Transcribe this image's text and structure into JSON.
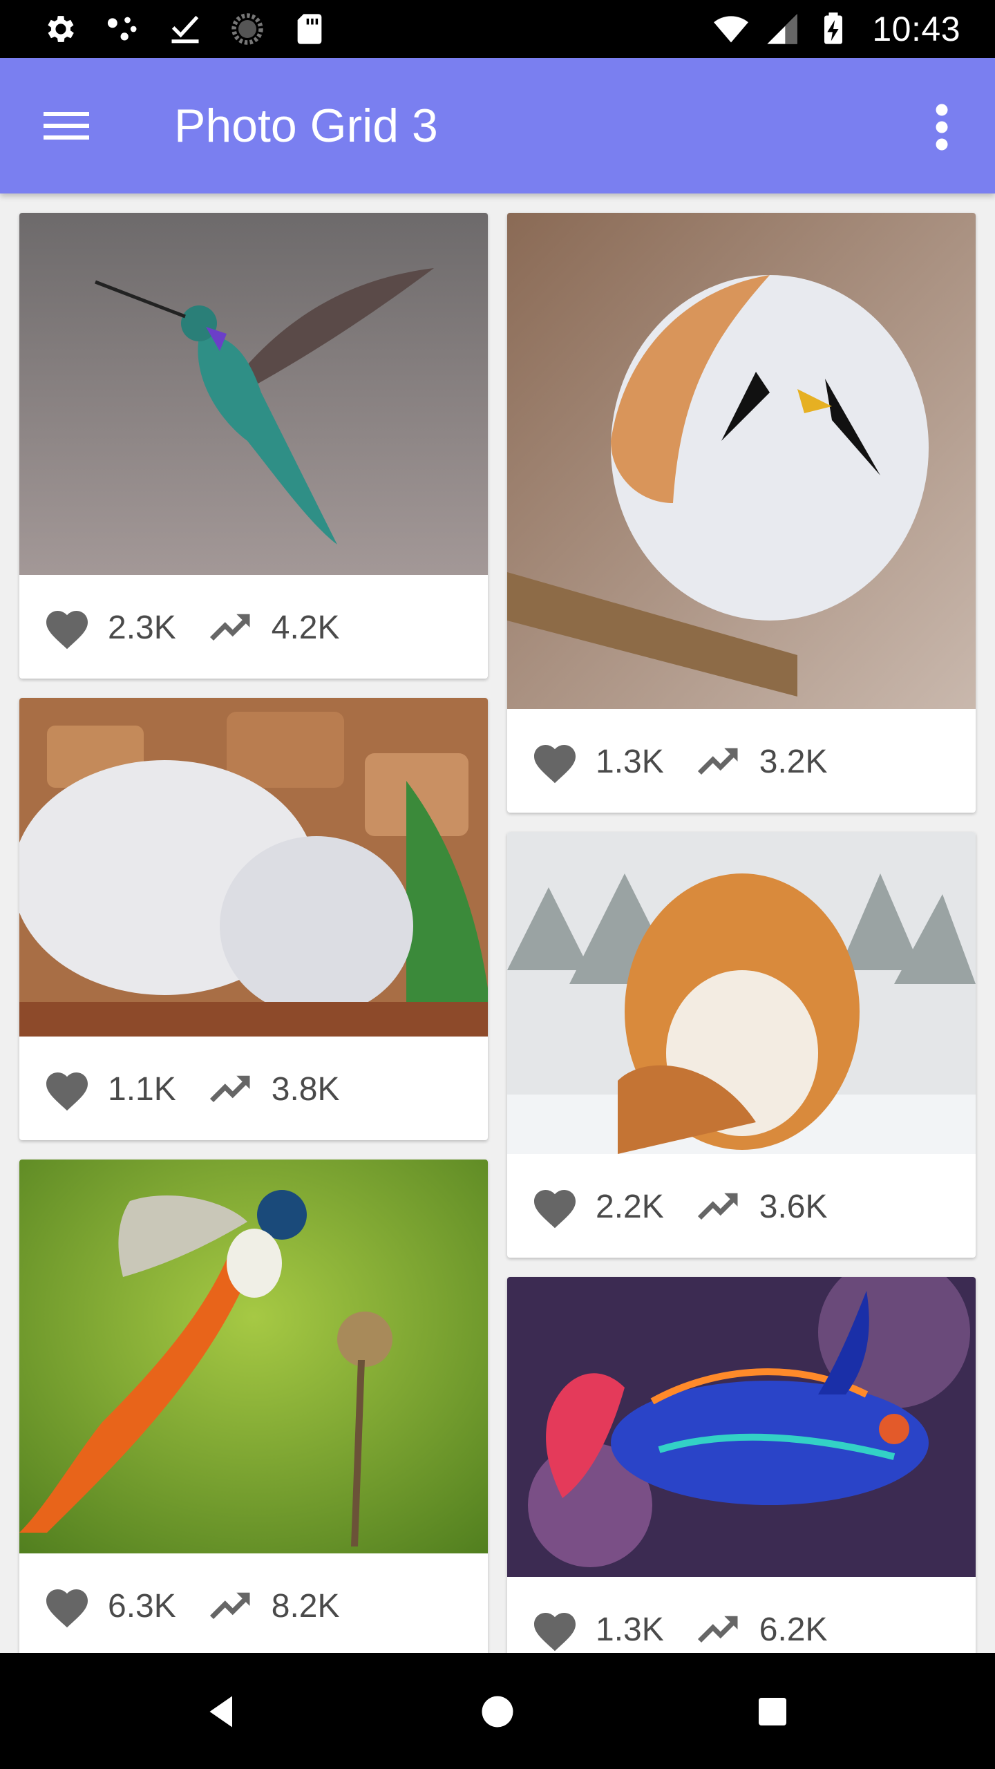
{
  "status_bar": {
    "time": "10:43",
    "left_icons": [
      "gear-icon",
      "share-icon",
      "download-done-icon",
      "sync-progress-icon",
      "sd-card-icon"
    ],
    "right_icons": [
      "wifi-icon",
      "cell-signal-icon",
      "battery-charging-icon"
    ]
  },
  "app_bar": {
    "title": "Photo Grid 3",
    "color": "#7a7ff0"
  },
  "cards": [
    {
      "subject": "hummingbird",
      "likes": "2.3K",
      "views": "4.2K"
    },
    {
      "subject": "round bird on branch",
      "likes": "1.3K",
      "views": "3.2K"
    },
    {
      "subject": "white tigers",
      "likes": "1.1K",
      "views": "3.8K"
    },
    {
      "subject": "tiger in snow",
      "likes": "2.2K",
      "views": "3.6K"
    },
    {
      "subject": "paradise flycatcher feeding chick",
      "likes": "6.3K",
      "views": "8.2K"
    },
    {
      "subject": "mandarin fish",
      "likes": "1.3K",
      "views": "6.2K"
    }
  ],
  "nav_bar": {
    "buttons": [
      "back-icon",
      "home-icon",
      "recents-icon"
    ]
  }
}
